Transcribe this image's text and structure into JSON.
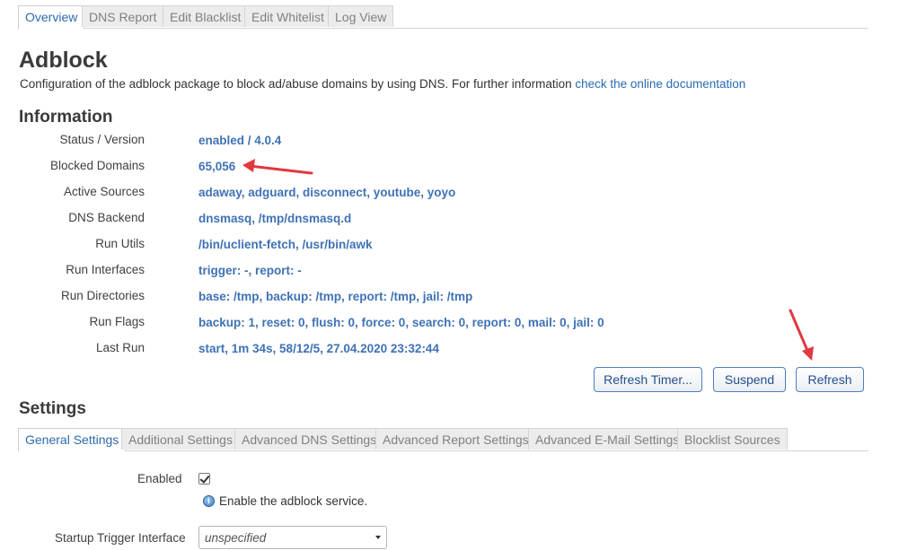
{
  "tabs": [
    {
      "label": "Overview",
      "active": true
    },
    {
      "label": "DNS Report",
      "active": false
    },
    {
      "label": "Edit Blacklist",
      "active": false
    },
    {
      "label": "Edit Whitelist",
      "active": false
    },
    {
      "label": "Log View",
      "active": false
    }
  ],
  "page": {
    "title": "Adblock",
    "description": "Configuration of the adblock package to block ad/abuse domains by using DNS. For further information",
    "doc_link": "check the online documentation"
  },
  "information": {
    "title": "Information",
    "rows": [
      {
        "label": "Status / Version",
        "value": "enabled / 4.0.4"
      },
      {
        "label": "Blocked Domains",
        "value": "65,056"
      },
      {
        "label": "Active Sources",
        "value": "adaway, adguard, disconnect, youtube, yoyo"
      },
      {
        "label": "DNS Backend",
        "value": "dnsmasq, /tmp/dnsmasq.d"
      },
      {
        "label": "Run Utils",
        "value": "/bin/uclient-fetch, /usr/bin/awk"
      },
      {
        "label": "Run Interfaces",
        "value": "trigger: -, report: -"
      },
      {
        "label": "Run Directories",
        "value": "base: /tmp, backup: /tmp, report: /tmp, jail: /tmp"
      },
      {
        "label": "Run Flags",
        "value": "backup: 1, reset: 0, flush: 0, force: 0, search: 0, report: 0, mail: 0, jail: 0"
      },
      {
        "label": "Last Run",
        "value": "start, 1m 34s, 58/12/5, 27.04.2020 23:32:44"
      }
    ]
  },
  "actions": {
    "refresh_timer": "Refresh Timer...",
    "suspend": "Suspend",
    "refresh": "Refresh"
  },
  "settings": {
    "title": "Settings",
    "tabs": [
      {
        "label": "General Settings",
        "active": true
      },
      {
        "label": "Additional Settings",
        "active": false
      },
      {
        "label": "Advanced DNS Settings",
        "active": false
      },
      {
        "label": "Advanced Report Settings",
        "active": false
      },
      {
        "label": "Advanced E-Mail Settings",
        "active": false
      },
      {
        "label": "Blocklist Sources",
        "active": false
      }
    ],
    "enabled_label": "Enabled",
    "enabled_checked": true,
    "enabled_help": "Enable the adblock service.",
    "startup_trigger_label": "Startup Trigger Interface",
    "startup_trigger_value": "unspecified"
  },
  "colors": {
    "accent": "#2e6aae",
    "value_text": "#3f72b5",
    "annotation_arrow": "#e0393e"
  },
  "icons": {
    "checkbox": "checkmark-icon",
    "help": "info-icon",
    "select": "chevron-down-icon"
  }
}
